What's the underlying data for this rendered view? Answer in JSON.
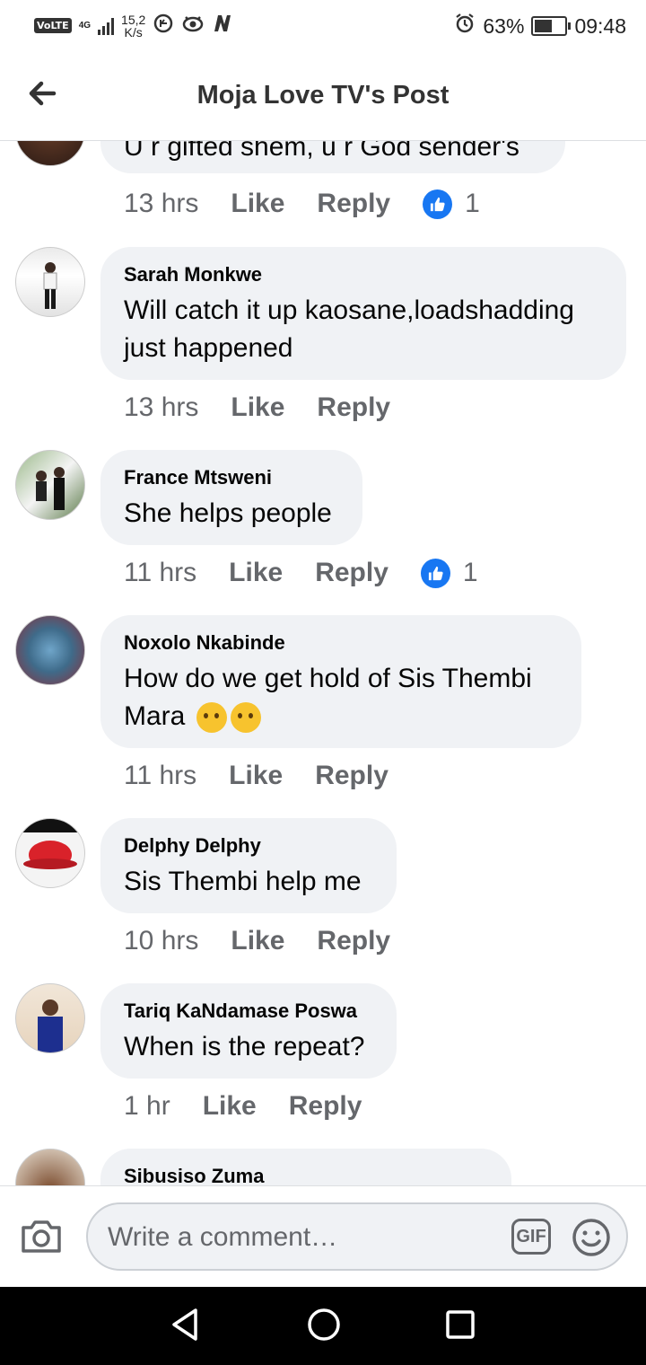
{
  "status_bar": {
    "volte": "VoLTE",
    "network": "4G",
    "speed_value": "15,2",
    "speed_unit": "K/s",
    "battery_pct": "63%",
    "battery_level": 0.63,
    "time": "09:48"
  },
  "header": {
    "title": "Moja Love TV's Post"
  },
  "comments": [
    {
      "name": "",
      "text": "U r gifted shem, u r God sender's",
      "time": "13 hrs",
      "like": "Like",
      "reply": "Reply",
      "reactions": "1"
    },
    {
      "name": "Sarah Monkwe",
      "text": "Will catch it up kaosane,loadshadding just happened",
      "time": "13 hrs",
      "like": "Like",
      "reply": "Reply",
      "reactions": ""
    },
    {
      "name": "France Mtsweni",
      "text": "She helps people",
      "time": "11 hrs",
      "like": "Like",
      "reply": "Reply",
      "reactions": "1"
    },
    {
      "name": "Noxolo Nkabinde",
      "text": "How do we get hold of Sis Thembi Mara",
      "time": "11 hrs",
      "like": "Like",
      "reply": "Reply",
      "reactions": ""
    },
    {
      "name": "Delphy Delphy",
      "text": "Sis Thembi help me",
      "time": "10 hrs",
      "like": "Like",
      "reply": "Reply",
      "reactions": ""
    },
    {
      "name": "Tariq KaNdamase Poswa",
      "text": "When is the repeat?",
      "time": "1 hr",
      "like": "Like",
      "reply": "Reply",
      "reactions": ""
    },
    {
      "name": "Sibusiso Zuma",
      "text": "",
      "time": "",
      "like": "",
      "reply": "",
      "reactions": ""
    }
  ],
  "composer": {
    "placeholder": "Write a comment…",
    "gif_label": "GIF"
  },
  "icons": {
    "back": "back-arrow-icon",
    "camera": "camera-icon",
    "emoji": "smiley-icon",
    "like_reaction": "thumbs-up-icon",
    "nav_back": "triangle-back-icon",
    "nav_home": "circle-home-icon",
    "nav_recents": "square-recents-icon"
  },
  "colors": {
    "accent": "#1877f2",
    "bubble": "#f0f2f5",
    "muted_text": "#65676b"
  }
}
